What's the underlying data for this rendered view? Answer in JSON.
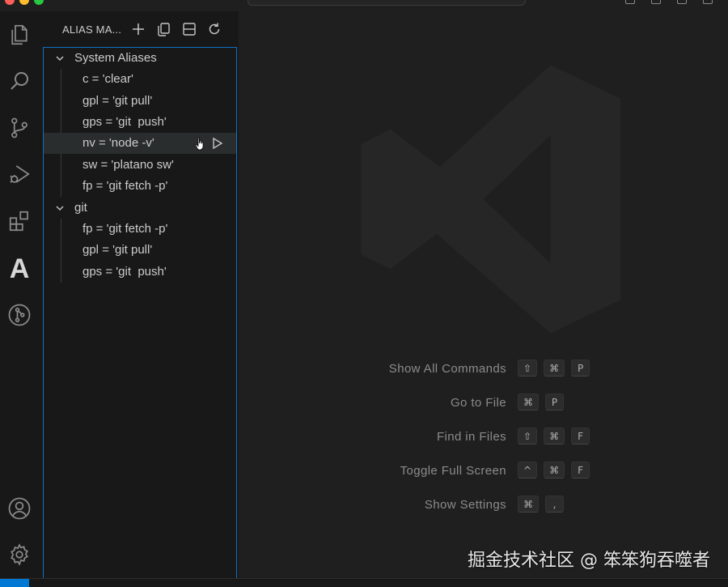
{
  "sidebar": {
    "title": "ALIAS MA...",
    "groups": [
      {
        "label": "System Aliases",
        "items": [
          {
            "label": "c = 'clear'"
          },
          {
            "label": "gpl = 'git pull'"
          },
          {
            "label": "gps = 'git  push'"
          },
          {
            "label": "nv = 'node -v'"
          },
          {
            "label": "sw = 'platano sw'"
          },
          {
            "label": "fp = 'git fetch -p'"
          }
        ]
      },
      {
        "label": "git",
        "items": [
          {
            "label": "fp = 'git fetch -p'"
          },
          {
            "label": "gpl = 'git pull'"
          },
          {
            "label": "gps = 'git  push'"
          }
        ]
      }
    ]
  },
  "activity_icons": [
    "explorer-icon",
    "search-icon",
    "source-control-icon",
    "run-debug-icon",
    "extensions-icon",
    "alias-manager-icon",
    "git-graph-icon",
    "account-icon",
    "settings-gear-icon"
  ],
  "editor": {
    "shortcuts": [
      {
        "label": "Show All Commands",
        "keys": [
          "⇧",
          "⌘",
          "P"
        ]
      },
      {
        "label": "Go to File",
        "keys": [
          "⌘",
          "P"
        ]
      },
      {
        "label": "Find in Files",
        "keys": [
          "⇧",
          "⌘",
          "F"
        ]
      },
      {
        "label": "Toggle Full Screen",
        "keys": [
          "^",
          "⌘",
          "F"
        ]
      },
      {
        "label": "Show Settings",
        "keys": [
          "⌘",
          ","
        ]
      }
    ],
    "watermark": "掘金技术社区 @ 笨笨狗吞噬者"
  },
  "colors": {
    "accent": "#0078d4",
    "focus_border": "#0f72c4",
    "background": "#1f1f1f",
    "sidebar": "#181818"
  }
}
